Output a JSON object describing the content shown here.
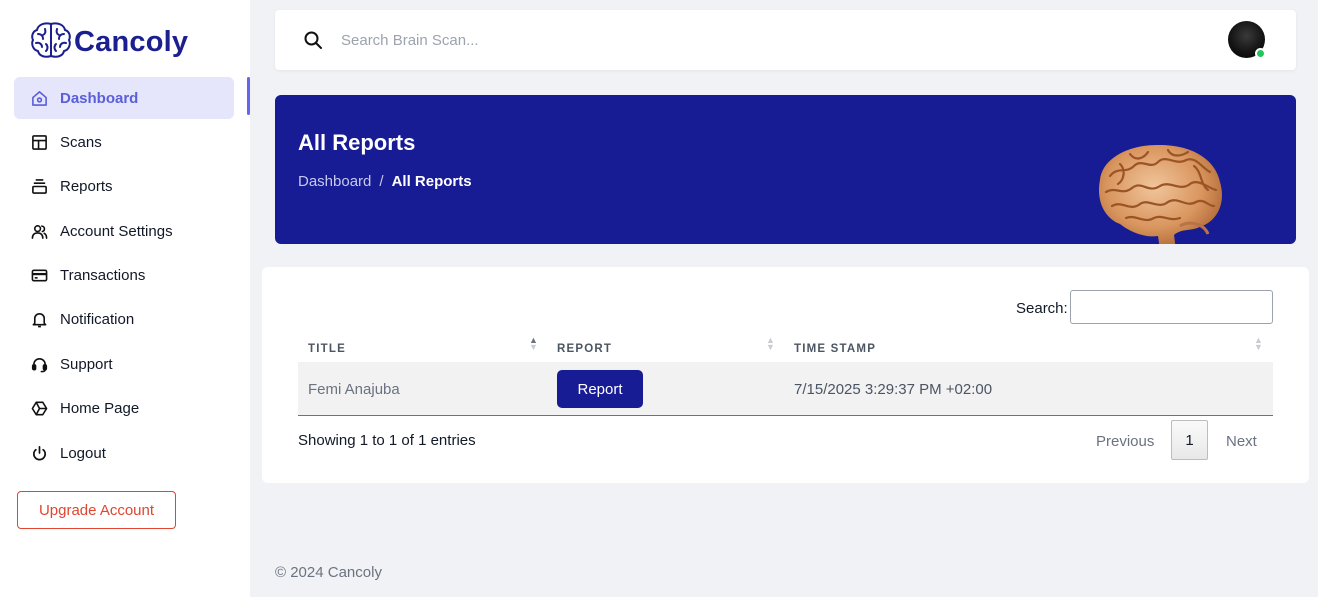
{
  "app": {
    "name": "Cancoly",
    "logo_icon": "brain-icon",
    "brand_color": "#171b94",
    "accent_color": "#5a5fd9"
  },
  "sidebar": {
    "items": [
      {
        "label": "Dashboard",
        "icon": "home-icon",
        "active": true
      },
      {
        "label": "Scans",
        "icon": "layout-icon"
      },
      {
        "label": "Reports",
        "icon": "stack-icon"
      },
      {
        "label": "Account Settings",
        "icon": "users-icon"
      },
      {
        "label": "Transactions",
        "icon": "credit-card-icon"
      },
      {
        "label": "Notification",
        "icon": "bell-icon"
      },
      {
        "label": "Support",
        "icon": "headset-icon"
      },
      {
        "label": "Home Page",
        "icon": "hexagon-icon"
      },
      {
        "label": "Logout",
        "icon": "power-icon"
      }
    ],
    "upgrade_label": "Upgrade Account",
    "upgrade_color": "#e0452f"
  },
  "topbar": {
    "search_placeholder": "Search Brain Scan...",
    "search_icon": "search-icon",
    "status_color": "#22c55e"
  },
  "banner": {
    "title": "All Reports",
    "breadcrumb": {
      "parent": "Dashboard",
      "separator": "/",
      "current": "All Reports"
    }
  },
  "table": {
    "search_label": "Search:",
    "columns": [
      "TITLE",
      "REPORT",
      "TIME STAMP"
    ],
    "rows": [
      {
        "title": "Femi Anajuba",
        "action_label": "Report",
        "timestamp": "7/15/2025 3:29:37 PM +02:00"
      }
    ],
    "info": "Showing 1 to 1 of 1 entries",
    "pagination": {
      "previous": "Previous",
      "current_page": "1",
      "next": "Next"
    }
  },
  "footer": {
    "text": "© 2024 Cancoly"
  }
}
